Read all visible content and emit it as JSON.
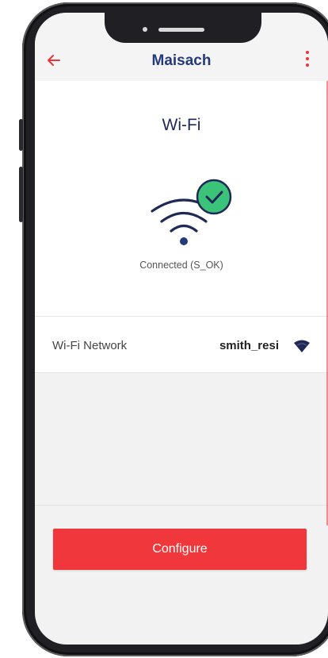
{
  "appbar": {
    "title": "Maisach",
    "back_icon": "arrow-left-icon",
    "menu_icon": "more-vert-icon"
  },
  "wifi": {
    "section_title": "Wi-Fi",
    "status_icon": "wifi-connected-icon",
    "status_text": "Connected (S_OK)"
  },
  "network_row": {
    "label": "Wi-Fi Network",
    "value": "smith_resi",
    "icon": "wifi-signal-icon"
  },
  "configure_button": {
    "label": "Configure"
  },
  "colors": {
    "accent": "#f0373c",
    "title": "#253a7a",
    "wifi_icon": "#1e2a55",
    "check_fill": "#3cc37a"
  }
}
